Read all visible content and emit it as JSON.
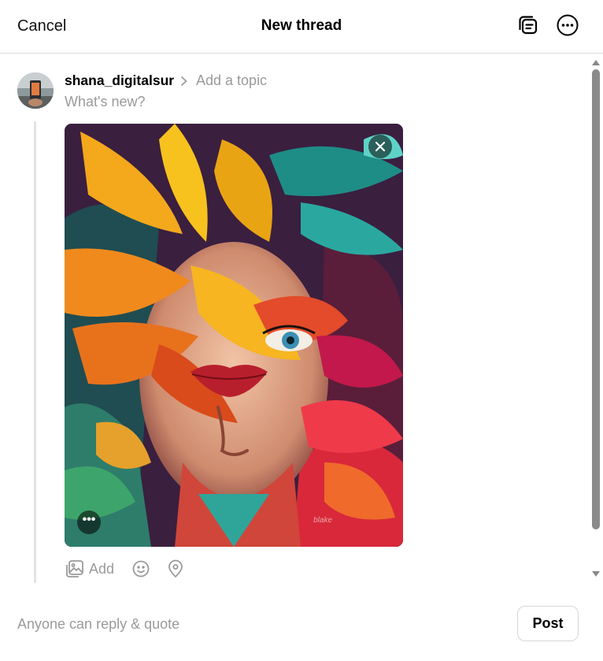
{
  "header": {
    "cancel_label": "Cancel",
    "title": "New thread",
    "drafts_icon": "drafts-icon",
    "more_icon": "more-options-icon"
  },
  "composer": {
    "username": "shana_digitalsur",
    "topic_placeholder": "Add a topic",
    "text_placeholder": "What's new?",
    "avatar_icon": "avatar"
  },
  "attachment": {
    "type": "image",
    "remove_icon": "close-icon",
    "options_label": "•••",
    "signature": "blake"
  },
  "toolbar": {
    "add_label": "Add",
    "media_icon": "gallery-icon",
    "emoji_icon": "emoji-icon",
    "location_icon": "location-pin-icon"
  },
  "footer": {
    "reply_setting": "Anyone can reply & quote",
    "post_label": "Post"
  },
  "colors": {
    "muted_text": "#9a9a9a",
    "border": "#dcdcdc",
    "thread_line": "#e3e3e3",
    "scroll_thumb": "#8a8a8a"
  }
}
